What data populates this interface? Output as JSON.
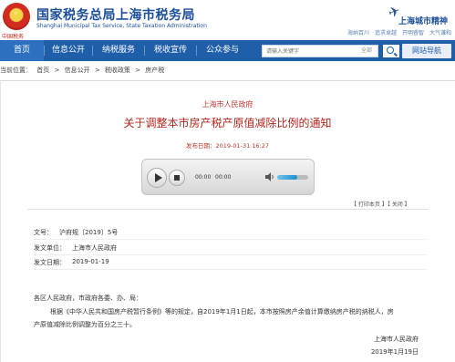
{
  "header": {
    "title_cn": "国家税务总局上海市税务局",
    "title_en": "Shanghai Municipal Tax Service, State Taxation Administration",
    "stamp": "中国税务",
    "brand": "上海城市精神",
    "service_links": [
      "海纳百川",
      "追求卓越",
      "开明睿智",
      "大气谦和"
    ]
  },
  "nav": {
    "items": [
      "首页",
      "信息公开",
      "纳税服务",
      "税收宣传",
      "公众参与"
    ],
    "search_placeholder": "请输入关键字",
    "search_scope": "全部",
    "site_nav_label": "网站导航"
  },
  "breadcrumb": {
    "prefix": "当前位置：",
    "items": [
      "首页",
      "信息公开",
      "税收政策",
      "房产税"
    ],
    "sep": ">"
  },
  "article": {
    "publisher": "上海市人民政府",
    "title": "关于调整本市房产税产原值减除比例的通知",
    "publish_date": "发布日期：2019-01-31 16:27",
    "tools": "【 打印本页 】【 关闭 】"
  },
  "player": {
    "current_time": "00:00",
    "total_time": "00:00",
    "volume_level": 0.65
  },
  "meta": {
    "doc_no_label": "文号：",
    "doc_no": "沪府规〔2019〕5号",
    "issuer_label": "发文单位：",
    "issuer": "上海市人民政府",
    "date_label": "发文日期：",
    "date": "2019-01-19"
  },
  "body": {
    "salutation": "各区人民政府，市政府各委、办、局：",
    "line1": "根据《中华人民共和国房产税暂行条例》等的规定，自2019年1月1日起，本市按照房产余值计算缴纳房产税的纳税人，房",
    "line2": "产原值减除比例调整为百分之三十。",
    "sign_org": "上海市人民政府",
    "sign_date": "2019年1月19日"
  },
  "colors": {
    "brand_blue": "#1c4e9a",
    "nav_blue": "#1f5ea8",
    "title_red": "#b2261c"
  }
}
